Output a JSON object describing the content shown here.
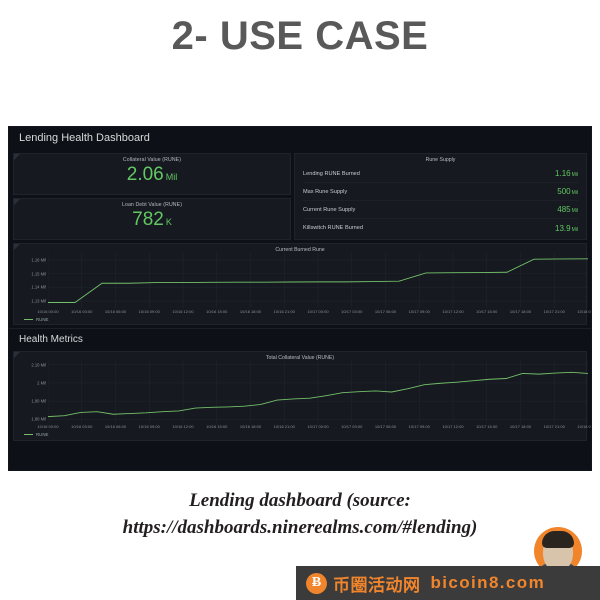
{
  "slide": {
    "title": "2- USE CASE",
    "caption_line1": "Lending dashboard (source:",
    "caption_line2": "https://dashboards.ninerealms.com/#lending)"
  },
  "dashboard": {
    "title": "Lending Health Dashboard",
    "section_health": "Health Metrics",
    "stats": [
      {
        "title": "Collateral Value (RUNE)",
        "value": "2.06",
        "unit": "Mil"
      },
      {
        "title": "Loan Debt Value (RUNE)",
        "value": "782",
        "unit": "K"
      }
    ],
    "rune_supply": {
      "title": "Rune Supply",
      "rows": [
        {
          "label": "Lending RUNE Burned",
          "value": "1.16",
          "unit": "Mil"
        },
        {
          "label": "Max Rune Supply",
          "value": "500",
          "unit": "Mil"
        },
        {
          "label": "Current Rune Supply",
          "value": "485",
          "unit": "Mil"
        },
        {
          "label": "Killswitch RUNE Burned",
          "value": "13.9",
          "unit": "Mil"
        }
      ]
    },
    "legend_label": "RUNE",
    "accent_green": "#73bf69",
    "value_green": "#63c763"
  },
  "watermark": {
    "icon": "bitcoin-icon",
    "icon_glyph": "Ƀ",
    "cn_text": "币圈活动网",
    "url_text": "bicoin8.com",
    "accent": "#f0852c"
  },
  "chart_data": [
    {
      "id": "current-burned-rune",
      "type": "line",
      "title": "Current Burned Rune",
      "xlabel": "",
      "ylabel": "",
      "ylim": [
        1.125,
        1.165
      ],
      "yticks": [
        1.13,
        1.14,
        1.15,
        1.16
      ],
      "ytick_labels": [
        "1.13 Mil",
        "1.14 Mil",
        "1.15 Mil",
        "1.16 Mil"
      ],
      "grid": true,
      "legend_position": "bottom-left",
      "series": [
        {
          "name": "RUNE",
          "color": "#73bf69",
          "x": [
            "10/16 00:00",
            "10/16 01:00",
            "10/16 01:30",
            "10/16 03:00",
            "10/16 06:00",
            "10/16 09:00",
            "10/16 12:00",
            "10/16 15:00",
            "10/16 18:00",
            "10/16 21:00",
            "10/17 00:00",
            "10/17 03:00",
            "10/17 06:00",
            "10/17 09:00",
            "10/17 09:10",
            "10/17 12:00",
            "10/17 15:00",
            "10/17 17:50",
            "10/17 18:00",
            "10/17 21:00",
            "10/18 00:00"
          ],
          "values": [
            1.129,
            1.129,
            1.143,
            1.143,
            1.1435,
            1.1435,
            1.1437,
            1.1438,
            1.1438,
            1.1439,
            1.144,
            1.144,
            1.1442,
            1.1445,
            1.1505,
            1.1507,
            1.1508,
            1.151,
            1.1605,
            1.1607,
            1.1608
          ]
        }
      ],
      "xtick_labels": [
        "10/16 00:00",
        "10/16 03:00",
        "10/16 06:00",
        "10/16 09:00",
        "10/16 12:00",
        "10/16 15:00",
        "10/16 18:00",
        "10/16 21:00",
        "10/17 00:00",
        "10/17 03:00",
        "10/17 06:00",
        "10/17 09:00",
        "10/17 12:00",
        "10/17 15:00",
        "10/17 18:00",
        "10/17 21:00",
        "10/18 00:00"
      ]
    },
    {
      "id": "total-collateral-value",
      "type": "line",
      "title": "Total Collateral Value (RUNE)",
      "xlabel": "",
      "ylabel": "",
      "ylim": [
        1.78,
        2.12
      ],
      "yticks": [
        1.8,
        1.9,
        2.0,
        2.1
      ],
      "ytick_labels": [
        "1.80 Mil",
        "1.90 Mil",
        "2 Mil",
        "2.10 Mil"
      ],
      "grid": true,
      "legend_position": "bottom-left",
      "series": [
        {
          "name": "RUNE",
          "color": "#73bf69",
          "x": [
            "10/16 00:00",
            "10/16 01:30",
            "10/16 03:00",
            "10/16 04:30",
            "10/16 06:00",
            "10/16 07:30",
            "10/16 09:00",
            "10/16 10:30",
            "10/16 12:00",
            "10/16 13:30",
            "10/16 15:00",
            "10/16 16:30",
            "10/16 18:00",
            "10/16 19:30",
            "10/16 21:00",
            "10/16 22:30",
            "10/17 00:00",
            "10/17 01:30",
            "10/17 03:00",
            "10/17 04:30",
            "10/17 06:00",
            "10/17 07:30",
            "10/17 09:00",
            "10/17 10:30",
            "10/17 12:00",
            "10/17 13:30",
            "10/17 15:00",
            "10/17 16:30",
            "10/17 17:40",
            "10/17 18:00",
            "10/17 19:30",
            "10/17 21:00",
            "10/17 22:30",
            "10/18 00:00"
          ],
          "values": [
            1.815,
            1.82,
            1.838,
            1.842,
            1.828,
            1.832,
            1.836,
            1.842,
            1.846,
            1.862,
            1.866,
            1.868,
            1.872,
            1.882,
            1.906,
            1.912,
            1.916,
            1.93,
            1.946,
            1.952,
            1.956,
            1.95,
            1.968,
            1.99,
            1.998,
            2.004,
            2.012,
            2.02,
            2.024,
            2.052,
            2.048,
            2.054,
            2.058,
            2.052
          ]
        }
      ],
      "xtick_labels": [
        "10/16 00:00",
        "10/16 03:00",
        "10/16 06:00",
        "10/16 09:00",
        "10/16 12:00",
        "10/16 15:00",
        "10/16 18:00",
        "10/16 21:00",
        "10/17 00:00",
        "10/17 03:00",
        "10/17 06:00",
        "10/17 09:00",
        "10/17 12:00",
        "10/17 15:00",
        "10/17 18:00",
        "10/17 21:00",
        "10/18 00:00"
      ]
    }
  ]
}
